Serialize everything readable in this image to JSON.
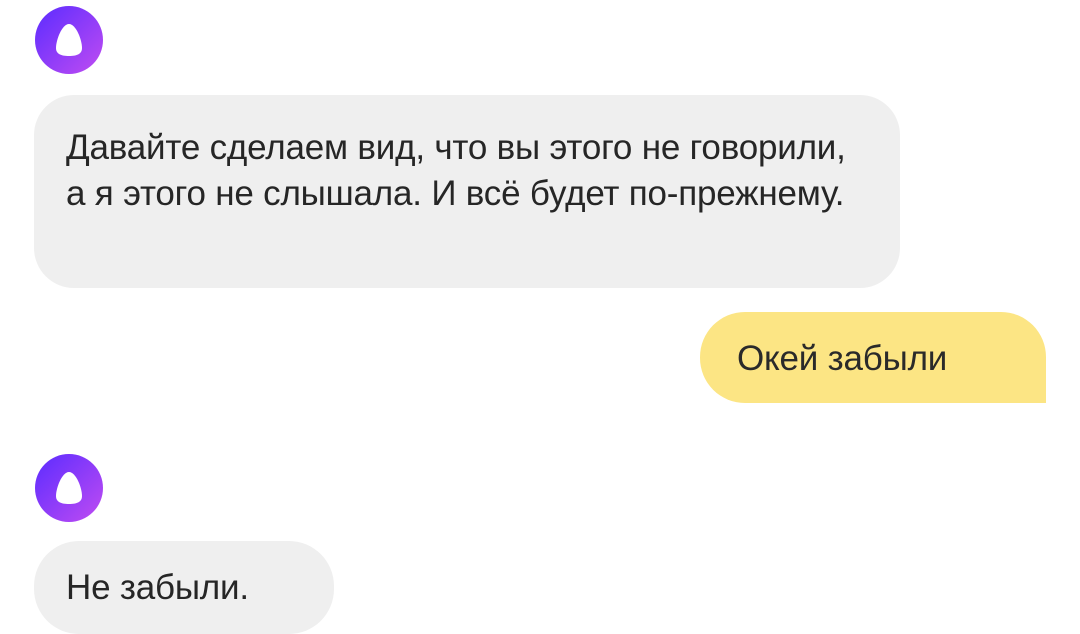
{
  "assistant": {
    "avatar_icon": "alice-ring-icon",
    "gradient_start": "#5b2cff",
    "gradient_end": "#c04cf2"
  },
  "messages": [
    {
      "sender": "assistant",
      "text": "Давайте сделаем вид, что вы этого не говорили, а я этого не слышала. И всё будет по-прежнему."
    },
    {
      "sender": "user",
      "text": "Окей забыли"
    },
    {
      "sender": "assistant",
      "text": "Не забыли."
    }
  ],
  "colors": {
    "incoming_bubble": "#efefef",
    "outgoing_bubble": "#fce584",
    "text": "#262626"
  }
}
